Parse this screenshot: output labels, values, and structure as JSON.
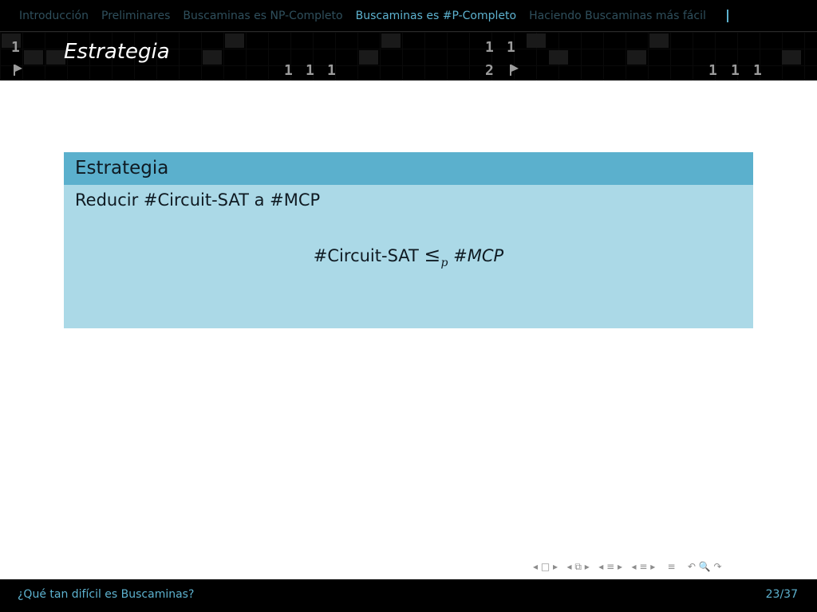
{
  "nav": {
    "items": [
      {
        "label": "Introducción",
        "active": false
      },
      {
        "label": "Preliminares",
        "active": false
      },
      {
        "label": "Buscaminas es NP-Completo",
        "active": false
      },
      {
        "label": "Buscaminas es #P-Completo",
        "active": true
      },
      {
        "label": "Haciendo Buscaminas más fácil",
        "active": false
      }
    ]
  },
  "band": {
    "digits": [
      "1",
      "1",
      "1",
      "1",
      "1",
      "1",
      "2",
      "1",
      "1",
      "1"
    ],
    "icon": "flag-icon"
  },
  "frame": {
    "title": "Estrategia"
  },
  "block": {
    "title": "Estrategia",
    "text": "Reducir #Circuit-SAT a #MCP",
    "formula": {
      "lhs": "#Circuit-SAT",
      "relation": "≤",
      "subscript": "p",
      "rhs": "#MCP"
    }
  },
  "navsymbols": {
    "items": [
      "◂",
      "□",
      "▸",
      "◂",
      "⧉",
      "▸",
      "◂",
      "≡",
      "▸",
      "◂",
      "≡",
      "▸",
      "≡",
      "↶",
      "🔍",
      "↷"
    ]
  },
  "footer": {
    "title": "¿Qué tan difícil es Buscaminas?",
    "page": "23/37"
  },
  "colors": {
    "accent": "#5db2cf",
    "block_header": "#5bb0cd",
    "block_body": "#abd9e7"
  }
}
